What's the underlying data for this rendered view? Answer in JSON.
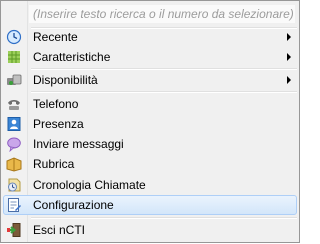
{
  "search": {
    "placeholder": "(Inserire testo ricerca o il numero da selezionare)"
  },
  "menu": {
    "items": [
      {
        "label": "Recente",
        "icon": "clock-icon",
        "submenu": true
      },
      {
        "label": "Caratteristiche",
        "icon": "grid-icon",
        "submenu": true
      },
      {
        "label": "Disponibilità",
        "icon": "availability-icon",
        "submenu": true
      },
      {
        "label": "Telefono",
        "icon": "phone-icon",
        "submenu": false
      },
      {
        "label": "Presenza",
        "icon": "presence-icon",
        "submenu": false
      },
      {
        "label": "Inviare messaggi",
        "icon": "chat-bubble-icon",
        "submenu": false
      },
      {
        "label": "Rubrica",
        "icon": "address-book-icon",
        "submenu": false
      },
      {
        "label": "Cronologia Chiamate",
        "icon": "call-history-icon",
        "submenu": false
      },
      {
        "label": "Configurazione",
        "icon": "configuration-icon",
        "submenu": false,
        "highlighted": true
      },
      {
        "label": "Esci nCTI",
        "icon": "exit-icon",
        "submenu": false
      }
    ]
  },
  "colors": {
    "highlight_border": "#aecff7",
    "highlight_fill": "#d3e6fa",
    "placeholder_text": "#9c9c9c"
  }
}
